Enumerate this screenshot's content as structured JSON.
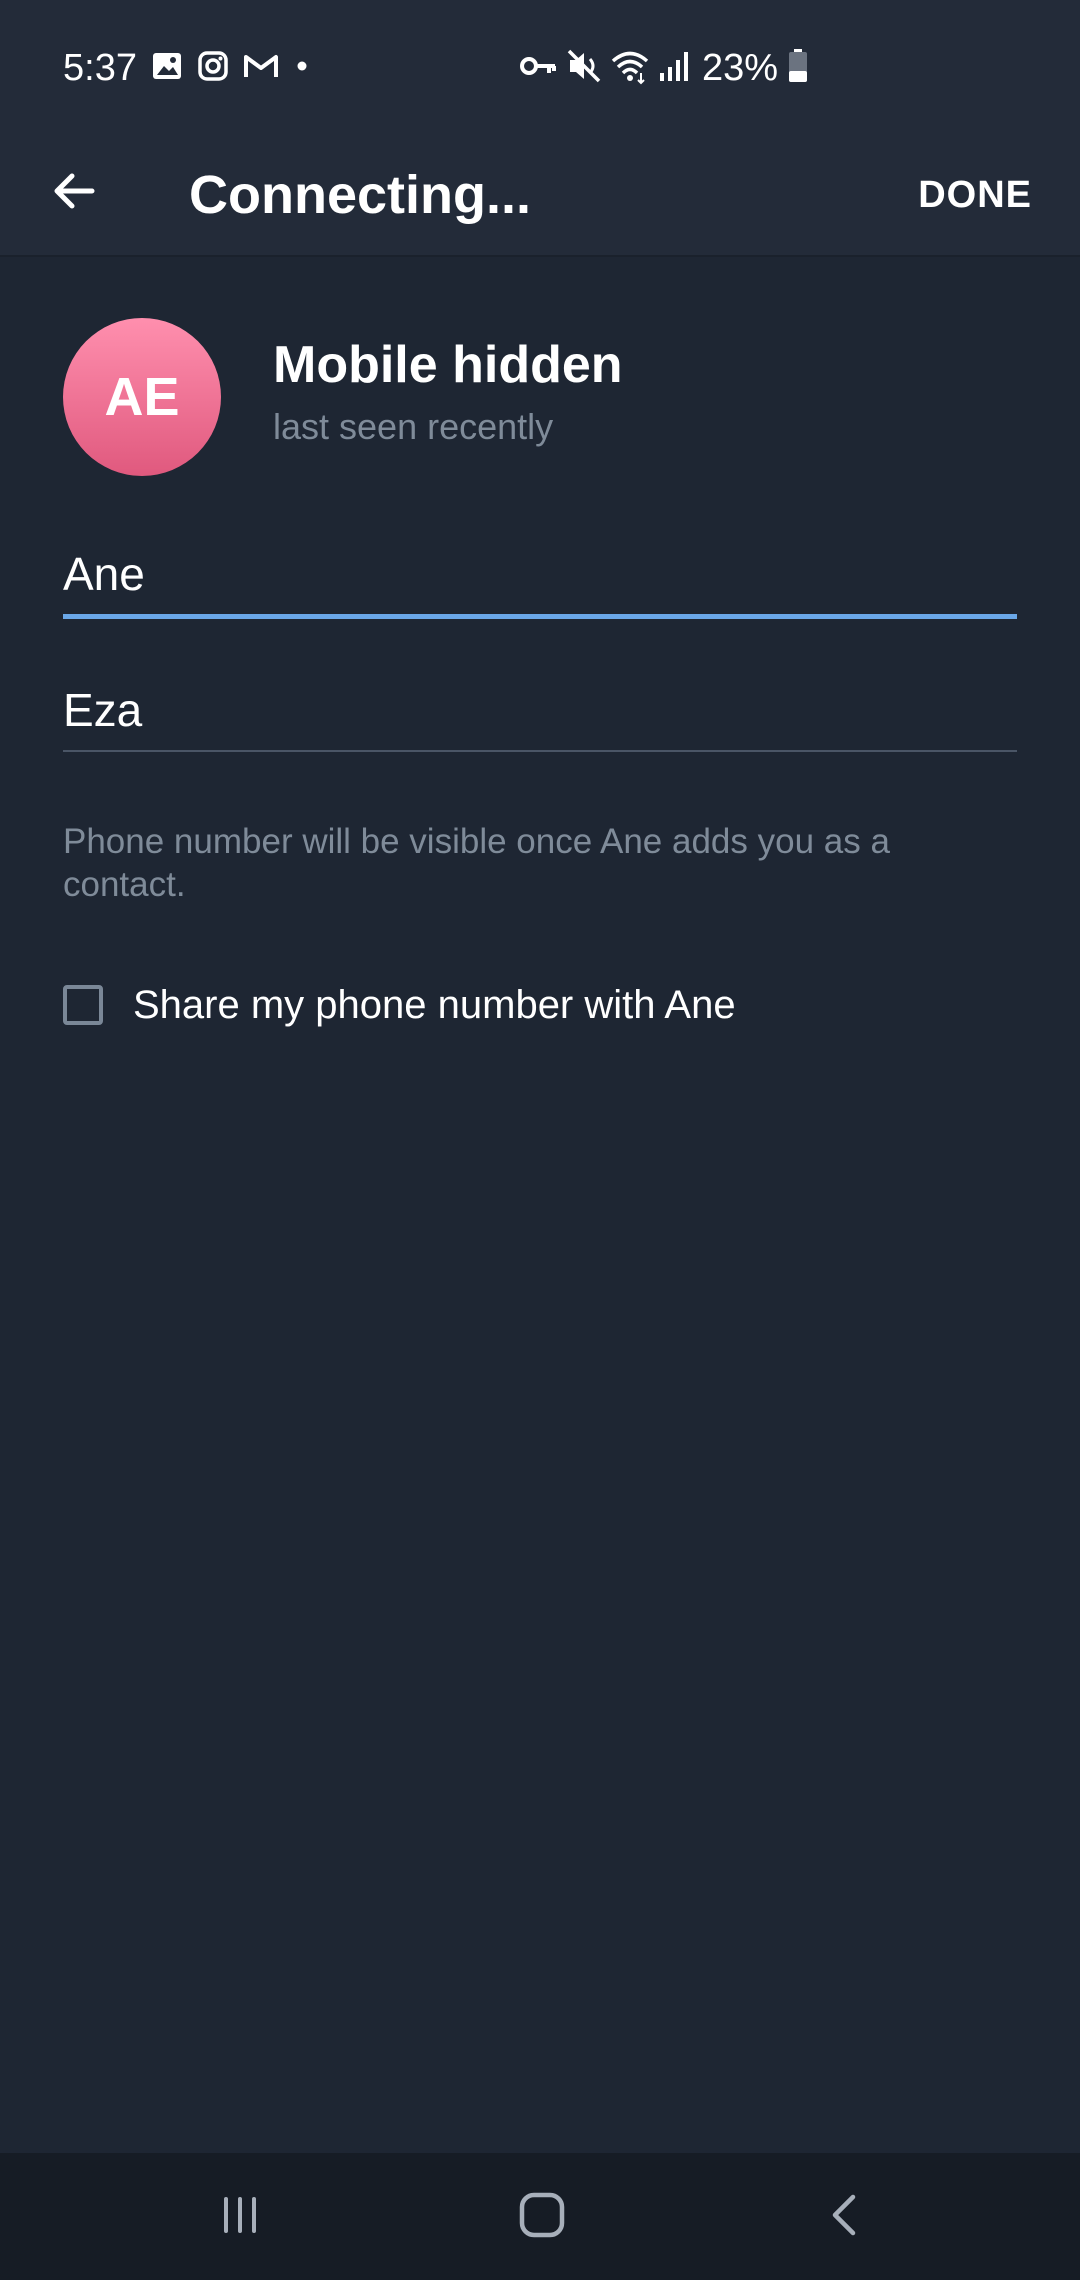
{
  "status_bar": {
    "time": "5:37",
    "left_icons": [
      "image-icon",
      "instagram-icon",
      "gmail-icon",
      "dot-icon"
    ],
    "right_icons": [
      "vpn-key-icon",
      "mute-icon",
      "wifi-icon",
      "signal-icon",
      "battery-icon"
    ],
    "battery_percent": "23%"
  },
  "toolbar": {
    "title": "Connecting...",
    "done_label": "DONE",
    "back_icon": "arrow-left-icon"
  },
  "profile": {
    "initials": "AE",
    "name": "Mobile hidden",
    "status": "last seen recently",
    "avatar_color_top": "#ff8fae",
    "avatar_color_bottom": "#e0597e"
  },
  "form": {
    "first_name": "Ane",
    "last_name": "Eza",
    "hint": "Phone number will be visible once Ane adds you as a contact.",
    "share_label": "Share my phone number with Ane",
    "share_checked": false
  },
  "colors": {
    "background": "#1e2633",
    "header": "#232b39",
    "accent": "#6aa7e8",
    "secondary_text": "#7f8b99"
  },
  "nav_bar": {
    "icons": [
      "recents-icon",
      "home-icon",
      "back-icon"
    ]
  }
}
